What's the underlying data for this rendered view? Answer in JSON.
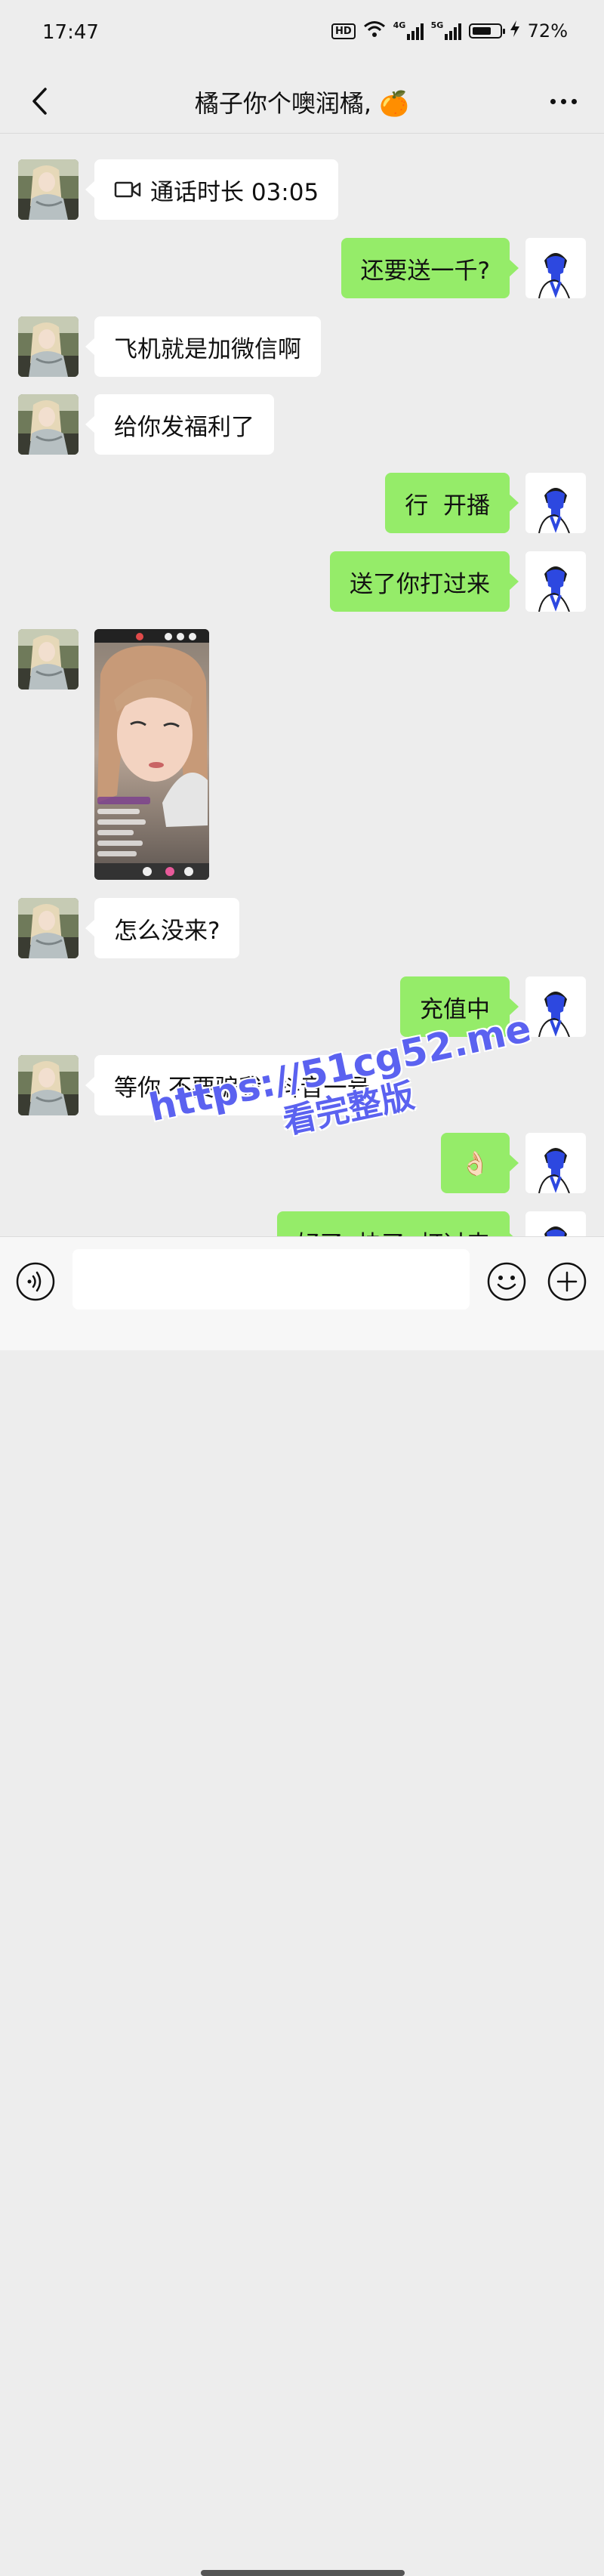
{
  "status_bar": {
    "time": "17:47",
    "hd_badge": "HD",
    "network_1": "4G",
    "network_2": "5G",
    "battery_percent": "72%",
    "battery_level": 0.72,
    "icons": [
      "hd-icon",
      "wifi-icon",
      "signal-icon",
      "signal-icon",
      "battery-icon",
      "charging-icon"
    ]
  },
  "header": {
    "title": "橘子你个噢润橘, 🍊",
    "back_icon": "chevron-left-icon",
    "more_icon": "more-dots-icon"
  },
  "messages": [
    {
      "side": "left",
      "type": "call",
      "icon": "video-camera-icon",
      "text": "通话时长 03:05"
    },
    {
      "side": "right",
      "type": "text",
      "text": "还要送一千?"
    },
    {
      "side": "left",
      "type": "text",
      "text": "飞机就是加微信啊"
    },
    {
      "side": "left",
      "type": "text",
      "text": "给你发福利了"
    },
    {
      "side": "right",
      "type": "text",
      "text": "行  开播"
    },
    {
      "side": "right",
      "type": "text",
      "text": "送了你打过来"
    },
    {
      "side": "left",
      "type": "image",
      "image": "livestream-screenshot"
    },
    {
      "side": "left",
      "type": "text",
      "text": "怎么没来?"
    },
    {
      "side": "right",
      "type": "text",
      "text": "充值中"
    },
    {
      "side": "left",
      "type": "text",
      "text": "等你 不要骗我  抖音一号"
    },
    {
      "side": "right",
      "type": "emoji",
      "text": "👌🏻"
    },
    {
      "side": "right",
      "type": "text",
      "text": "好了  快了  打过来"
    }
  ],
  "watermark": {
    "url": "https://51cg52.me",
    "subtitle": "看完整版"
  },
  "input_bar": {
    "voice_icon": "voice-icon",
    "message_value": "",
    "emoji_icon": "emoji-icon",
    "add_icon": "plus-icon"
  },
  "colors": {
    "background": "#ededed",
    "bubble_received": "#ffffff",
    "bubble_sent": "#95ec69",
    "watermark": "#5b62f0"
  }
}
